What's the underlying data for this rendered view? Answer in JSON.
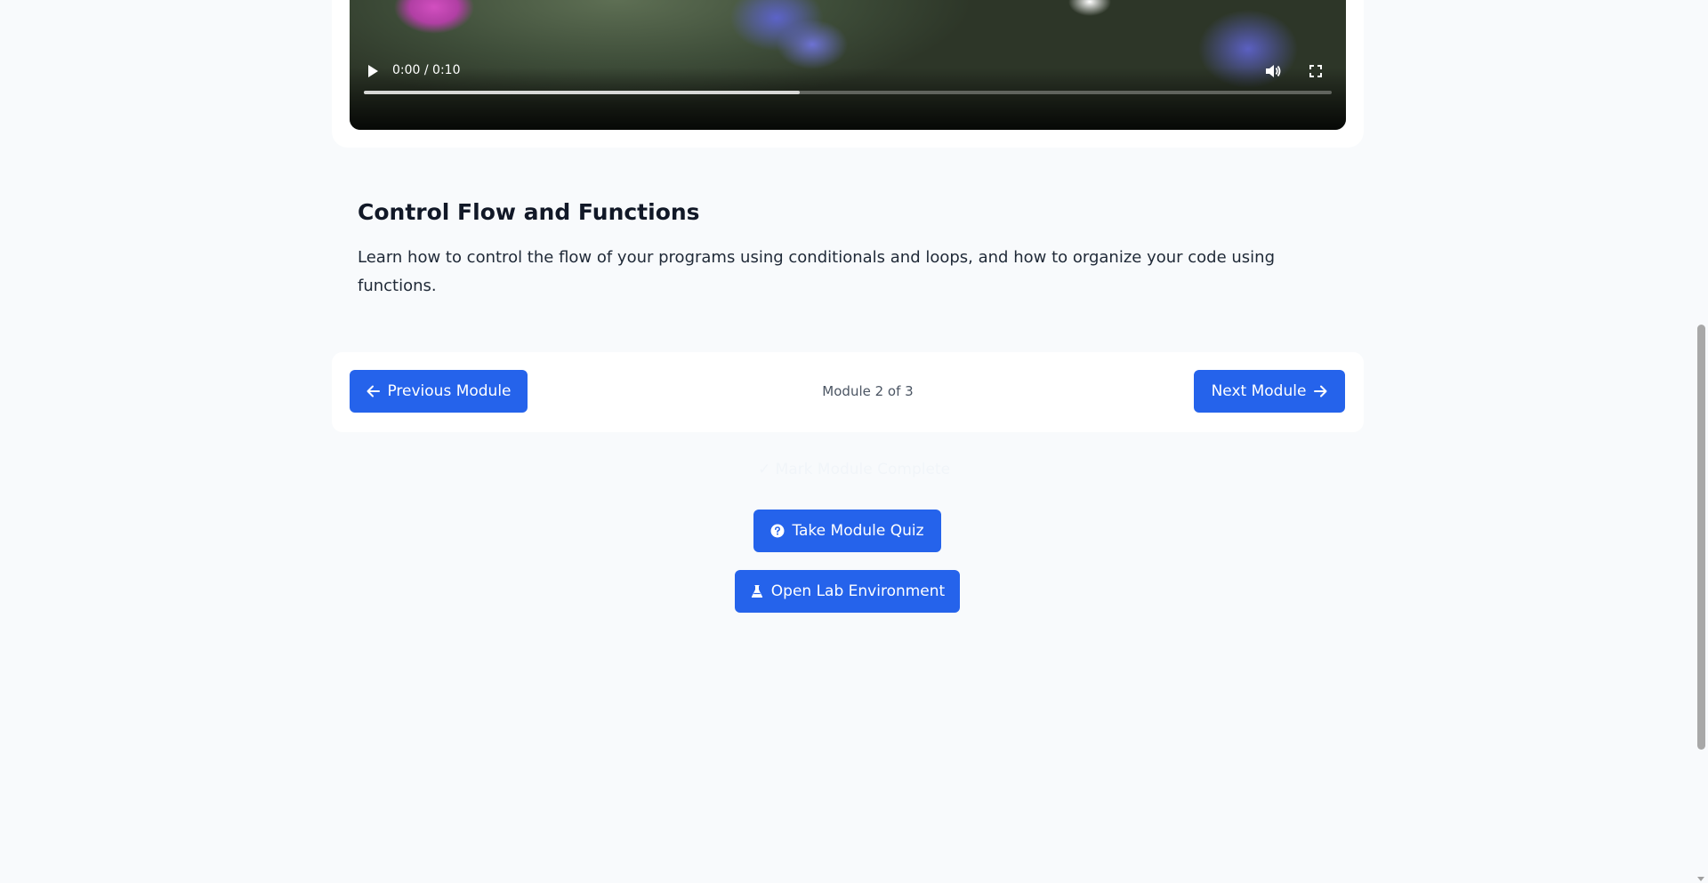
{
  "video": {
    "time_display": "0:00 / 0:10",
    "progress": 0.45
  },
  "lesson": {
    "title": "Control Flow and Functions",
    "description": "Learn how to control the flow of your programs using conditionals and loops, and how to organize your code using functions."
  },
  "navigation": {
    "prev_label": "Previous Module",
    "module_counter": "Module 2 of 3",
    "next_label": "Next Module"
  },
  "actions": {
    "mark_complete_label": "✓ Mark Module Complete",
    "quiz_label": "Take Module Quiz",
    "lab_label": "Open Lab Environment"
  },
  "colors": {
    "primary": "#2563eb",
    "background": "#f8fafc",
    "card": "#ffffff"
  },
  "icons": {
    "prev": "arrow-left-icon",
    "next": "arrow-right-icon",
    "quiz": "question-circle-icon",
    "lab": "flask-icon",
    "play": "play-icon",
    "volume": "volume-icon",
    "fullscreen": "fullscreen-icon",
    "more": "more-options-icon"
  }
}
